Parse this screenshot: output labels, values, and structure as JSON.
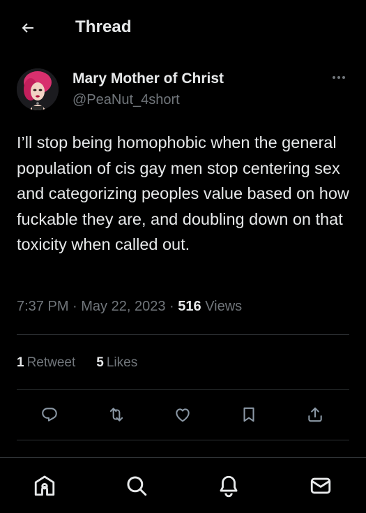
{
  "header": {
    "title": "Thread",
    "back_icon": "arrow-left-icon"
  },
  "tweet": {
    "author": {
      "display_name": "Mary Mother of Christ",
      "handle": "@PeaNut_4short"
    },
    "text": "I’ll stop being homophobic when the general population of cis gay men stop centering sex and categorizing peoples value based on how fuckable they are, and doubling down on that toxicity when called out.",
    "time": "7:37 PM",
    "separator": " · ",
    "date": "May 22, 2023",
    "views_count": "516",
    "views_label": "Views",
    "retweets_count": "1",
    "retweets_label": "Retweet",
    "likes_count": "5",
    "likes_label": "Likes"
  },
  "actions": [
    "reply-icon",
    "retweet-icon",
    "like-icon",
    "bookmark-icon",
    "share-icon"
  ],
  "bottom_nav": [
    "home-icon",
    "search-icon",
    "notifications-icon",
    "messages-icon"
  ],
  "colors": {
    "background": "#000000",
    "text_primary": "#e7e9ea",
    "text_secondary": "#71767b",
    "divider": "#2f3336"
  }
}
